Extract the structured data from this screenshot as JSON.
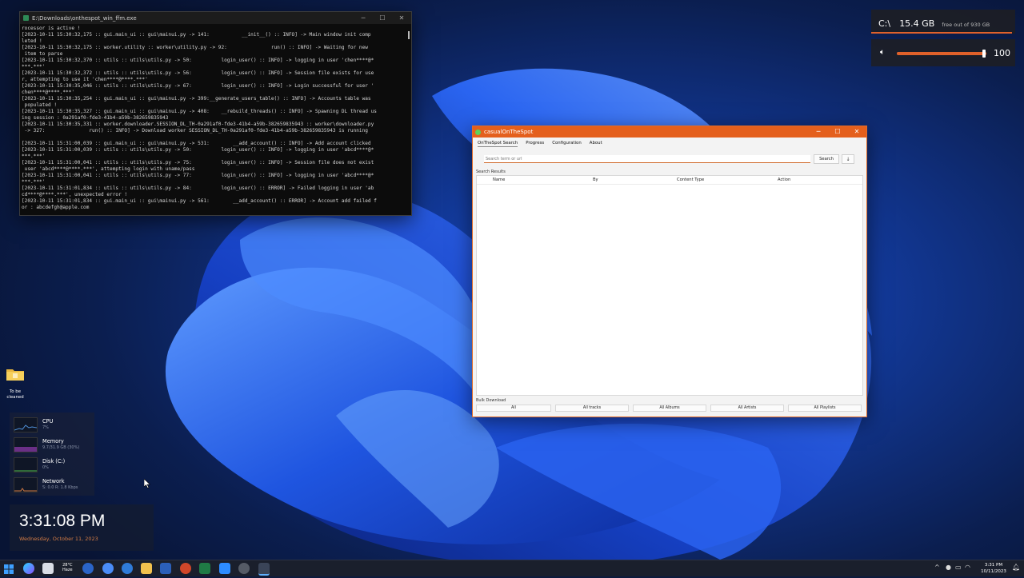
{
  "console": {
    "title": "E:\\Downloads\\onthespot_win_ffm.exe",
    "lines": [
      "rocessor is active !",
      "[2023-10-11 15:30:32,175 :: gui.main_ui :: gui\\mainui.py -> 141:           __init__() :: INFO] -> Main window init comp",
      "leted !",
      "[2023-10-11 15:30:32,175 :: worker.utility :: worker\\utility.py -> 92:               run() :: INFO] -> Waiting for new",
      " item to parse",
      "[2023-10-11 15:30:32,370 :: utils :: utils\\utils.py -> 50:          login_user() :: INFO] -> logging in user 'chen****@*",
      "***.***'",
      "[2023-10-11 15:30:32,372 :: utils :: utils\\utils.py -> 56:          login_user() :: INFO] -> Session file exists for use",
      "r, attempting to use it 'chen****@****.***'",
      "[2023-10-11 15:30:35,046 :: utils :: utils\\utils.py -> 67:          login_user() :: INFO] -> Login successful for user '",
      "chen****@****.***'",
      "[2023-10-11 15:30:35,254 :: gui.main_ui :: gui\\mainui.py -> 399:__generate_users_table() :: INFO] -> Accounts table was",
      " populated !",
      "[2023-10-11 15:30:35,327 :: gui.main_ui :: gui\\mainui.py -> 408:    __rebuild_threads() :: INFO] -> Spawning DL thread us",
      "ing session : 0a291af0-fde3-41b4-a59b-382659835943",
      "[2023-10-11 15:30:35,331 :: worker.downloader.SESSION_DL_TH-0a291af0-fde3-41b4-a59b-382659835943 :: worker\\downloader.py",
      " -> 327:               run() :: INFO] -> Download worker SESSION_DL_TH-0a291af0-fde3-41b4-a59b-382659835943 is running",
      "",
      "[2023-10-11 15:31:00,039 :: gui.main_ui :: gui\\mainui.py -> 531:        __add_account() :: INFO] -> Add account clicked",
      "[2023-10-11 15:31:00,039 :: utils :: utils\\utils.py -> 50:          login_user() :: INFO] -> logging in user 'abcd****@*",
      "***.***'",
      "[2023-10-11 15:31:00,041 :: utils :: utils\\utils.py -> 75:          login_user() :: INFO] -> Session file does not exist",
      " user 'abcd****@****.***', attempting login with uname/pass",
      "[2023-10-11 15:31:00,041 :: utils :: utils\\utils.py -> 77:          login_user() :: INFO] -> logging in user 'abcd****@*",
      "***.***'",
      "[2023-10-11 15:31:01,834 :: utils :: utils\\utils.py -> 84:          login_user() :: ERROR] -> Failed logging in user 'ab",
      "cd****@****.***', unexpected error !",
      "[2023-10-11 15:31:01,834 :: gui.main_ui :: gui\\mainui.py -> 561:        __add_account() :: ERROR] -> Account add failed f",
      "or : abcdefgh@apple.com"
    ]
  },
  "app": {
    "title": "casualOnTheSpot",
    "menu": [
      "OnTheSpot Search",
      "Progress",
      "Configuration",
      "About"
    ],
    "search_placeholder": "Search term or url",
    "search_button": "Search",
    "down_button": "↓",
    "results_label": "Search Results",
    "columns": [
      "Name",
      "By",
      "Content Type",
      "Action"
    ],
    "bulk_label": "Bulk Download",
    "bulk_buttons": [
      "All",
      "All tracks",
      "All Albums",
      "All Artists",
      "All Playlists"
    ]
  },
  "disk": {
    "drive": "C:\\",
    "size": "15.4 GB",
    "free_text": "free out of 930 GB",
    "used_fraction": 0.98
  },
  "volume": {
    "value": "100",
    "level_fraction": 1.0
  },
  "desktop_icon": {
    "label": "To be cleaned"
  },
  "perf": [
    {
      "name": "CPU",
      "sub": "7%",
      "color": "#4f8fd6"
    },
    {
      "name": "Memory",
      "sub": "9.7/31.9 GB (30%)",
      "color": "#a24fc7"
    },
    {
      "name": "Disk (C:)",
      "sub": "0%",
      "color": "#4fbf4f"
    },
    {
      "name": "Network",
      "sub": "S: 0.0 R: 1.8 Kbps",
      "color": "#d27b44"
    }
  ],
  "clock": {
    "time": "3:31:08 PM",
    "date": "Wednesday, October 11, 2023"
  },
  "taskbar": {
    "weather_temp": "28°C",
    "weather_desc": "Haze",
    "time": "3:31 PM",
    "date": "10/11/2023",
    "icons": [
      "start-icon",
      "copilot-icon",
      "file-explorer-icon",
      "terminal-icon",
      "edge-icon",
      "chrome-icon",
      "photos-icon",
      "folder-icon",
      "word-icon",
      "powerpoint-icon",
      "excel-icon",
      "zoom-icon",
      "settings-icon",
      "onthespot-icon"
    ],
    "colors": {
      "accent": "#e45f1c"
    }
  }
}
